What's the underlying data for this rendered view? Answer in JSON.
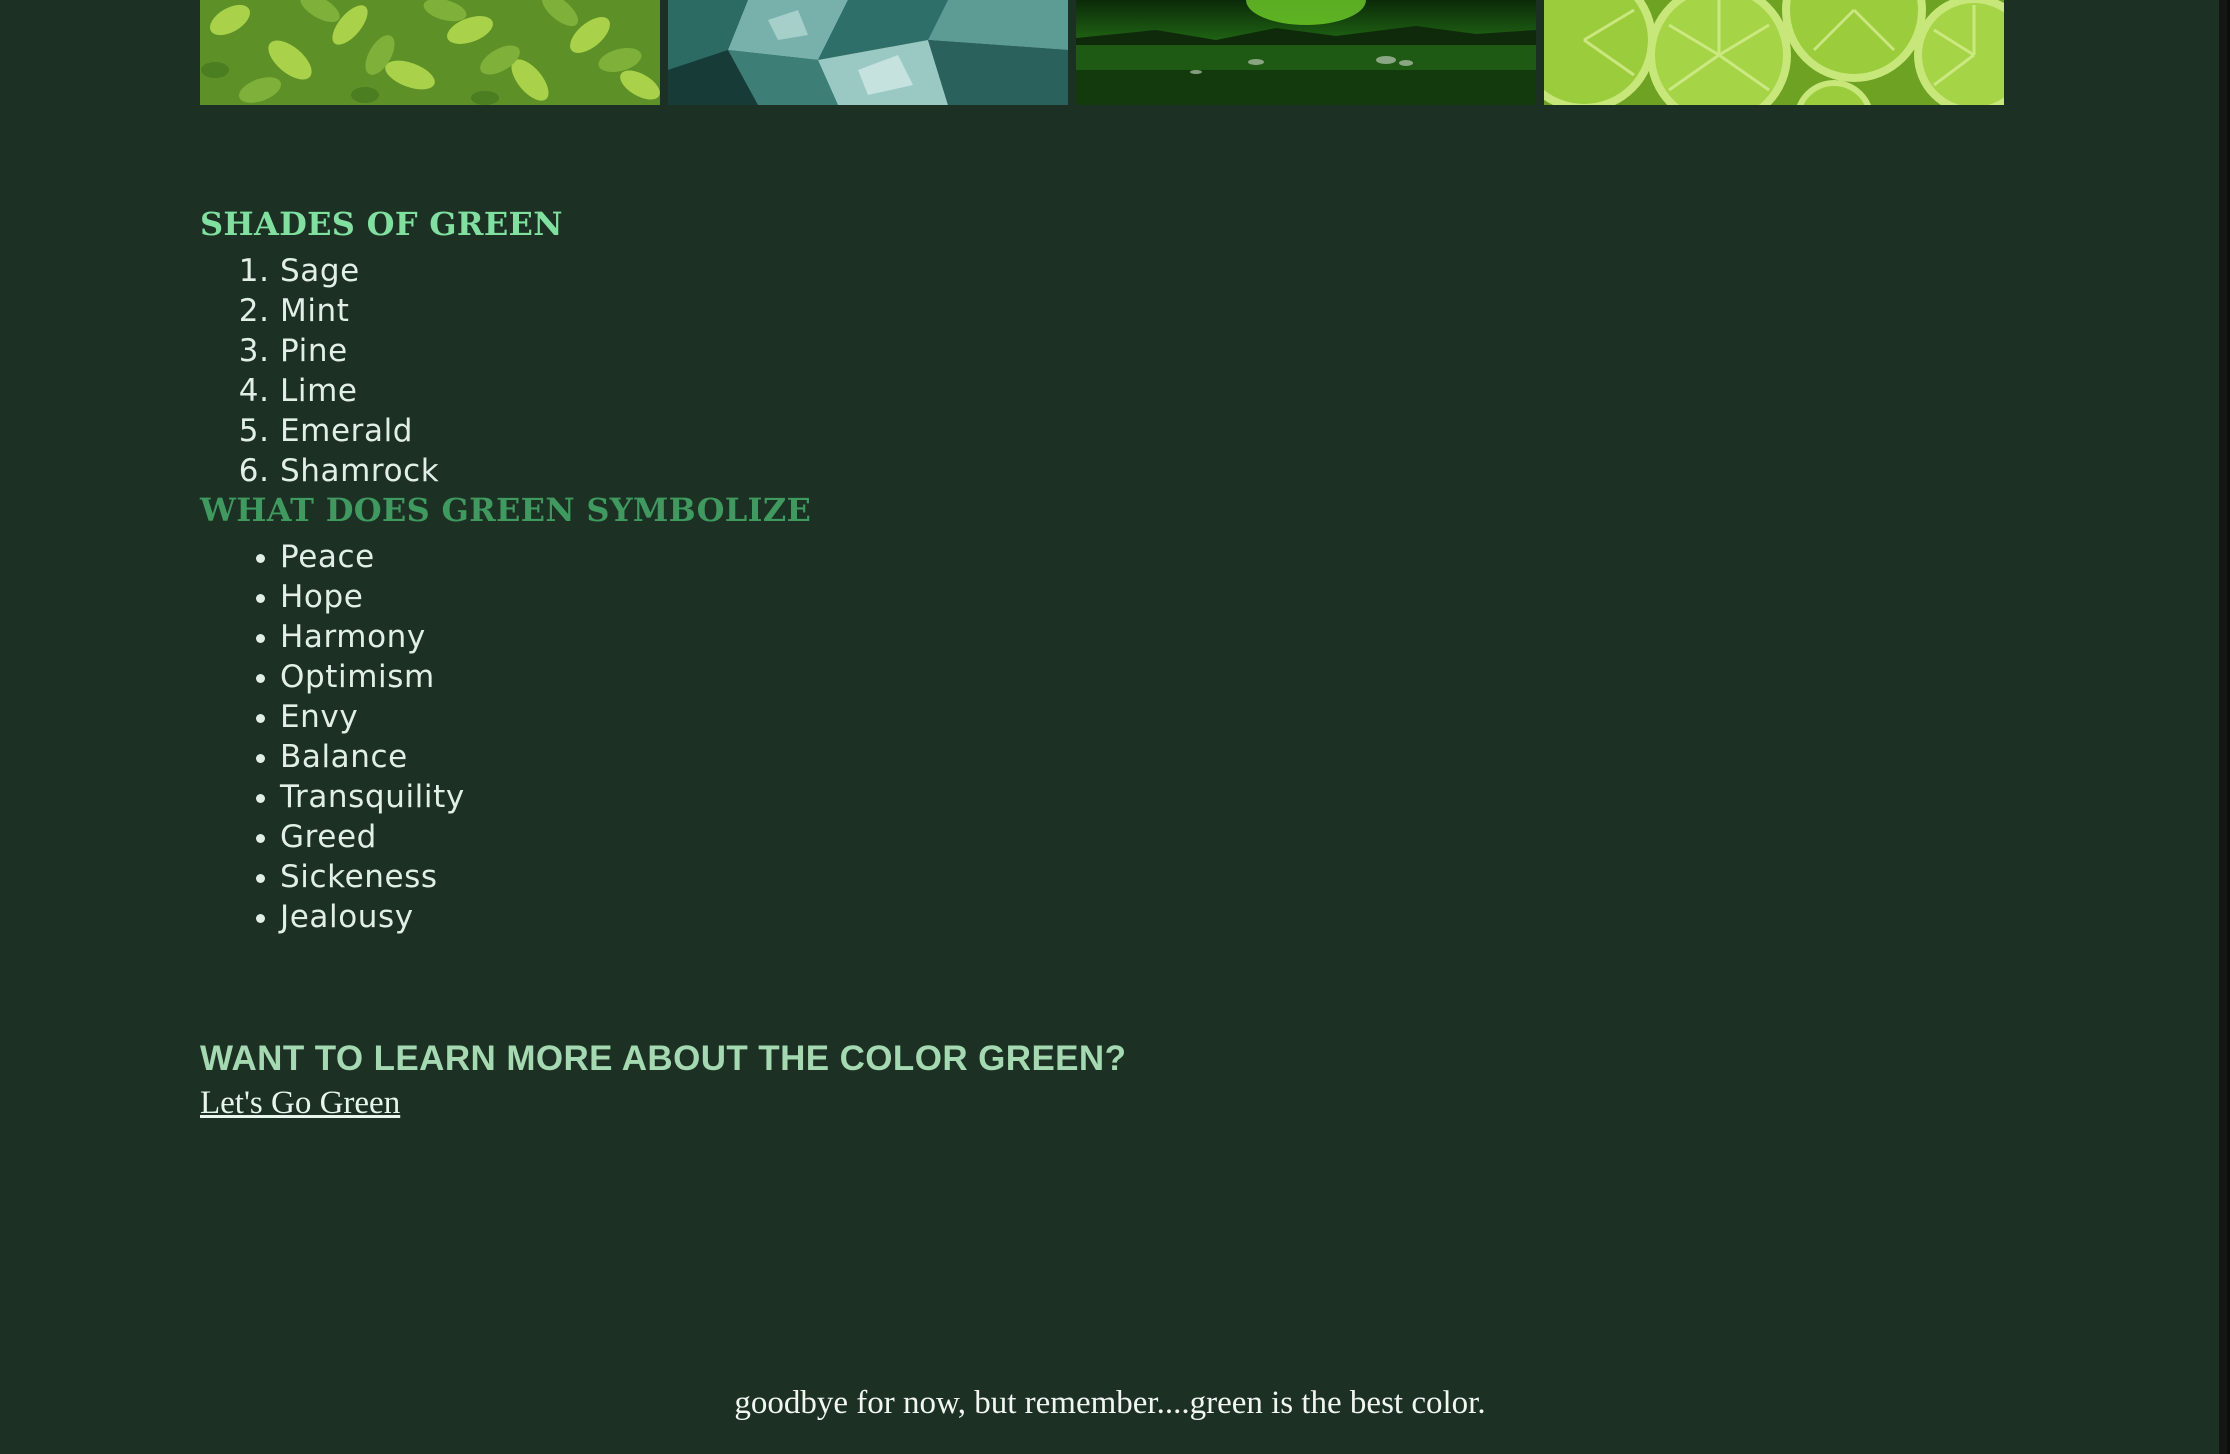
{
  "gallery": {
    "images": [
      {
        "name": "leaves-image",
        "colors": [
          "#7fb03a",
          "#a9d24a",
          "#4e8a25"
        ]
      },
      {
        "name": "glass-image",
        "colors": [
          "#2c6a64",
          "#78b1ab",
          "#173b37"
        ]
      },
      {
        "name": "aurora-lake-image",
        "colors": [
          "#1d5e12",
          "#6fcd28",
          "#0b1d08"
        ]
      },
      {
        "name": "lime-slices-image",
        "colors": [
          "#9bcc3c",
          "#d6ed8f",
          "#6ea222"
        ]
      }
    ]
  },
  "shades": {
    "heading": "SHADES OF GREEN",
    "items": [
      "Sage",
      "Mint",
      "Pine",
      "Lime",
      "Emerald",
      "Shamrock"
    ]
  },
  "symbolize": {
    "heading": "WHAT DOES GREEN SYMBOLIZE",
    "items": [
      "Peace",
      "Hope",
      "Harmony",
      "Optimism",
      "Envy",
      "Balance",
      "Transquility",
      "Greed",
      "Sickeness",
      "Jealousy"
    ]
  },
  "learn_more": {
    "heading": "WANT TO LEARN MORE ABOUT THE COLOR GREEN?",
    "link_text": "Let's Go Green"
  },
  "footer": {
    "text": "goodbye for now, but remember....green is the best color."
  },
  "colors": {
    "background": "#1c3124",
    "heading_light": "#7fe0a0",
    "heading_dark": "#3f9a5f",
    "heading_learn": "#a4d9b1",
    "text": "#e2efe6"
  }
}
